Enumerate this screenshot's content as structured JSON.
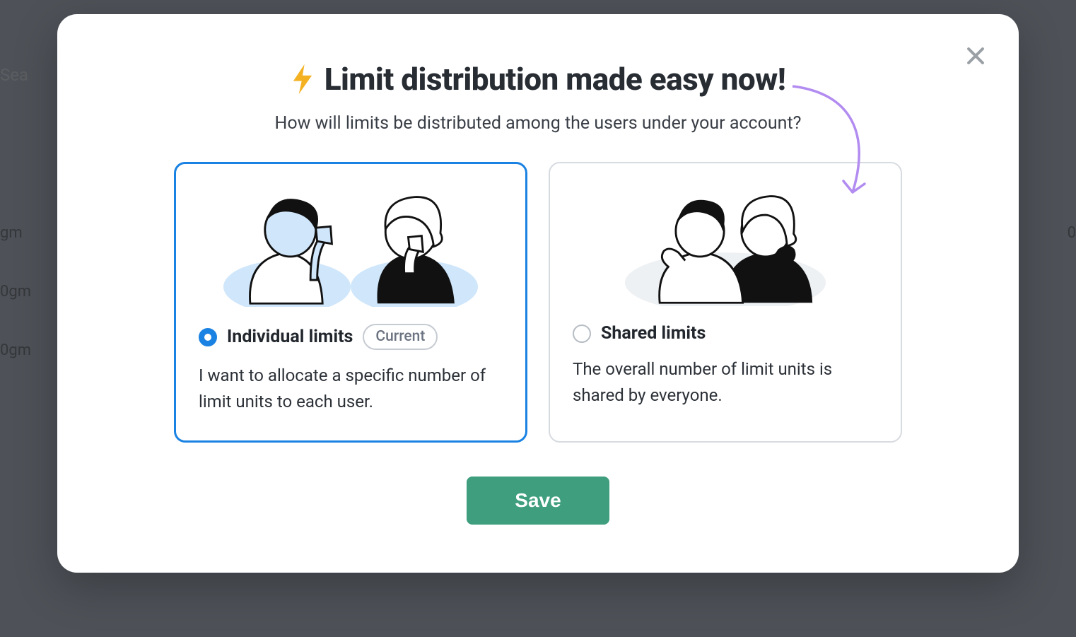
{
  "background": {
    "search_fragment": "Sea",
    "row1_fragment": "gm",
    "row2_fragment": "0gm",
    "row3_fragment": "0gm",
    "right_cell_fragment": "0"
  },
  "modal": {
    "title": "Limit distribution made easy now!",
    "subtitle": "How will limits be distributed among the users under your account?",
    "options": {
      "individual": {
        "label": "Individual limits",
        "badge": "Current",
        "description": "I want to allocate a specific number of limit units to each user.",
        "selected": true
      },
      "shared": {
        "label": "Shared limits",
        "description": "The overall number of limit units is shared by everyone.",
        "selected": false
      }
    },
    "save_label": "Save"
  }
}
